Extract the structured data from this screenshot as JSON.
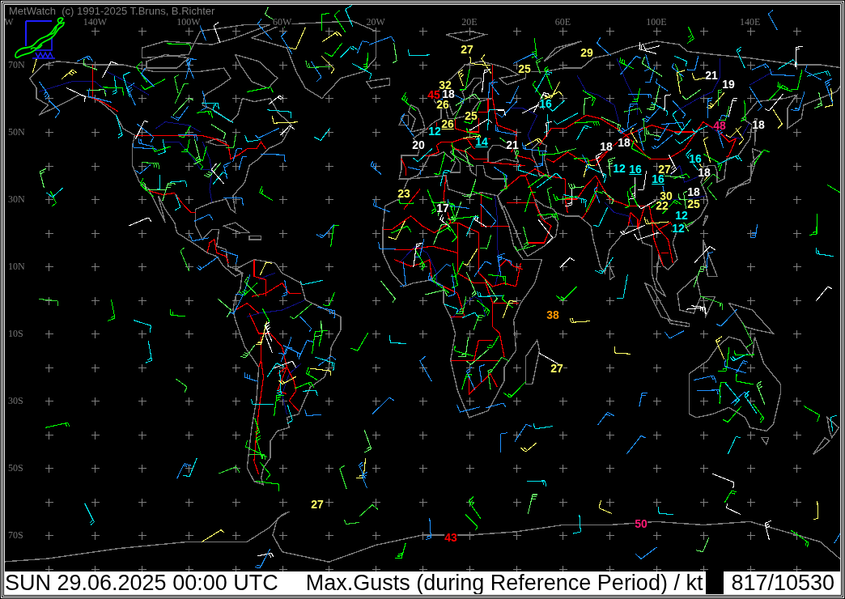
{
  "window": {
    "title": "MetWatch  (c) 1991-2025 T.Bruns, B.Richter"
  },
  "map": {
    "longitude_labels": [
      "W",
      "140W",
      "100W",
      "60W",
      "20W",
      "20E",
      "60E",
      "100E",
      "140E"
    ],
    "latitude_labels": [
      "70N",
      "50N",
      "30N",
      "10N",
      "10S",
      "30S",
      "50S",
      "70S"
    ],
    "gust_labels": [
      {
        "text": "27",
        "color": "#ffff66",
        "underlined": false
      },
      {
        "text": "29",
        "color": "#ffff66",
        "underlined": false
      },
      {
        "text": "25",
        "color": "#ffff66",
        "underlined": false
      },
      {
        "text": "21",
        "color": "#ffffff",
        "underlined": false
      },
      {
        "text": "32",
        "color": "#ffff66",
        "underlined": false
      },
      {
        "text": "19",
        "color": "#ffffff",
        "underlined": false
      },
      {
        "text": "45",
        "color": "#ff0000",
        "underlined": false
      },
      {
        "text": "18",
        "color": "#ffffff",
        "underlined": false
      },
      {
        "text": "26",
        "color": "#ffff66",
        "underlined": false
      },
      {
        "text": "16",
        "color": "#00ffff",
        "underlined": false
      },
      {
        "text": "25",
        "color": "#ffff66",
        "underlined": false
      },
      {
        "text": "26",
        "color": "#ffff66",
        "underlined": true
      },
      {
        "text": "48",
        "color": "#ff1a75",
        "underlined": false
      },
      {
        "text": "18",
        "color": "#ffffff",
        "underlined": false
      },
      {
        "text": "12",
        "color": "#00ffff",
        "underlined": false
      },
      {
        "text": "20",
        "color": "#ffffff",
        "underlined": false
      },
      {
        "text": "14",
        "color": "#00ffff",
        "underlined": true
      },
      {
        "text": "21",
        "color": "#ffffff",
        "underlined": false
      },
      {
        "text": "18",
        "color": "#ffffff",
        "underlined": false
      },
      {
        "text": "18",
        "color": "#ffffff",
        "underlined": false
      },
      {
        "text": "16",
        "color": "#00ffff",
        "underlined": false
      },
      {
        "text": "12",
        "color": "#00ffff",
        "underlined": false
      },
      {
        "text": "16",
        "color": "#00ffff",
        "underlined": true
      },
      {
        "text": "27",
        "color": "#ffff66",
        "underlined": false
      },
      {
        "text": "18",
        "color": "#ffffff",
        "underlined": false
      },
      {
        "text": "16",
        "color": "#00ffff",
        "underlined": true
      },
      {
        "text": "23",
        "color": "#ffff66",
        "underlined": false
      },
      {
        "text": "30",
        "color": "#ffff66",
        "underlined": false
      },
      {
        "text": "18",
        "color": "#ffffff",
        "underlined": false
      },
      {
        "text": "17",
        "color": "#ffffff",
        "underlined": false
      },
      {
        "text": "22",
        "color": "#ffff66",
        "underlined": false
      },
      {
        "text": "25",
        "color": "#ffff66",
        "underlined": false
      },
      {
        "text": "12",
        "color": "#00ffff",
        "underlined": false
      },
      {
        "text": "12",
        "color": "#00ffff",
        "underlined": false
      },
      {
        "text": "38",
        "color": "#ff9900",
        "underlined": false
      },
      {
        "text": "27",
        "color": "#ffff66",
        "underlined": false
      },
      {
        "text": "27",
        "color": "#ffff66",
        "underlined": false
      },
      {
        "text": "50",
        "color": "#ff1a75",
        "underlined": false
      },
      {
        "text": "43",
        "color": "#ff0000",
        "underlined": false
      }
    ]
  },
  "status_bar": {
    "datetime": "SUN 29.06.2025 00:00 UTC",
    "parameter": "Max.Gusts (during Reference Period) / kt",
    "count": "817/10530"
  }
}
